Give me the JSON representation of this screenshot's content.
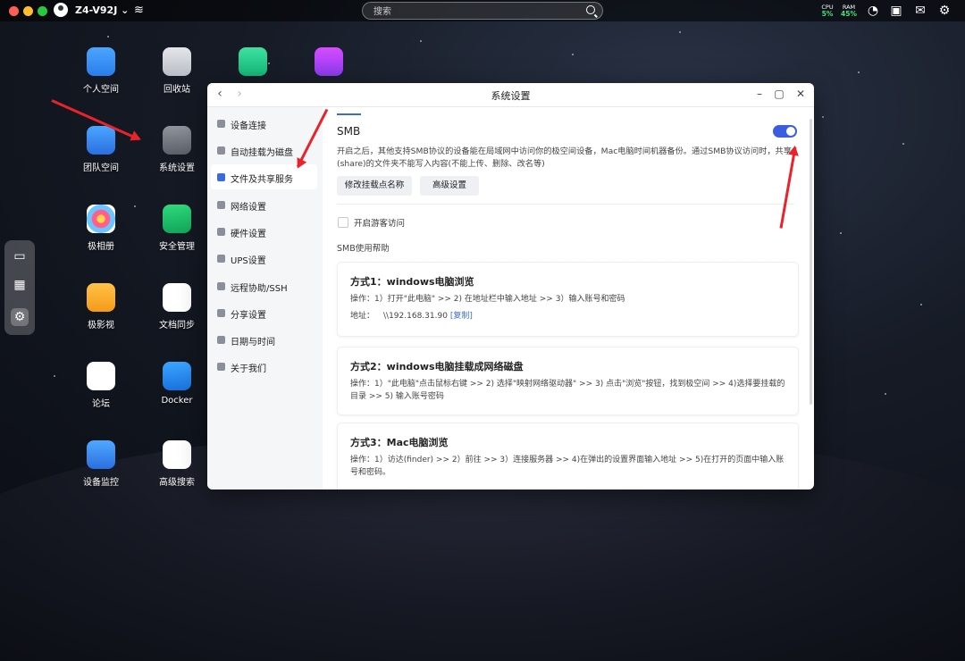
{
  "topbar": {
    "device_name": "Z4-V92J",
    "search_placeholder": "搜索",
    "cpu": {
      "label": "CPU",
      "value": "5%"
    },
    "ram": {
      "label": "RAM",
      "value": "45%"
    }
  },
  "desktop_icons": [
    {
      "label": "个人空间"
    },
    {
      "label": "回收站"
    },
    {
      "label": ""
    },
    {
      "label": ""
    },
    {
      "label": "团队空间"
    },
    {
      "label": "系统设置"
    },
    {
      "label": "极相册"
    },
    {
      "label": "安全管理"
    },
    {
      "label": "极影视"
    },
    {
      "label": "文档同步"
    },
    {
      "label": "论坛"
    },
    {
      "label": "Docker"
    },
    {
      "label": "设备监控"
    },
    {
      "label": "高级搜索"
    }
  ],
  "window": {
    "title": "系统设置",
    "sidebar": [
      {
        "label": "设备连接"
      },
      {
        "label": "自动挂载为磁盘"
      },
      {
        "label": "文件及共享服务",
        "active": true
      },
      {
        "label": "网络设置"
      },
      {
        "label": "硬件设置"
      },
      {
        "label": "UPS设置"
      },
      {
        "label": "远程协助/SSH"
      },
      {
        "label": "分享设置"
      },
      {
        "label": "日期与时间"
      },
      {
        "label": "关于我们"
      }
    ],
    "smb": {
      "title": "SMB",
      "enabled": true,
      "description": "开启之后，其他支持SMB协议的设备能在局域网中访问你的极空间设备，Mac电脑时间机器备份。通过SMB协议访问时，共享(share)的文件夹不能写入内容(不能上传、删除、改名等)",
      "rename_button": "修改挂载点名称",
      "advanced_button": "高级设置",
      "guest_access_label": "开启游客访问",
      "help_title": "SMB使用帮助",
      "methods": [
        {
          "title": "方式1：windows电脑浏览",
          "steps": "操作：1）打开\"此电脑\" >> 2) 在地址栏中输入地址 >> 3）输入账号和密码",
          "address_label": "地址：",
          "address": "\\\\192.168.31.90",
          "copy_label": "[复制]"
        },
        {
          "title": "方式2：windows电脑挂载成网络磁盘",
          "steps": "操作：1）\"此电脑\"点击鼠标右键 >> 2) 选择\"映射网络驱动器\" >> 3) 点击\"浏览\"按钮，找到极空间 >> 4)选择要挂载的目录 >> 5) 输入账号密码"
        },
        {
          "title": "方式3：Mac电脑浏览",
          "steps": "操作：1）访达(finder) >> 2）前往 >> 3）连接服务器 >> 4)在弹出的设置界面输入地址 >> 5)在打开的页面中输入账号和密码。"
        }
      ]
    }
  },
  "colors": {
    "accent": "#3b5ee0",
    "annotation_arrow": "#e8232a"
  }
}
